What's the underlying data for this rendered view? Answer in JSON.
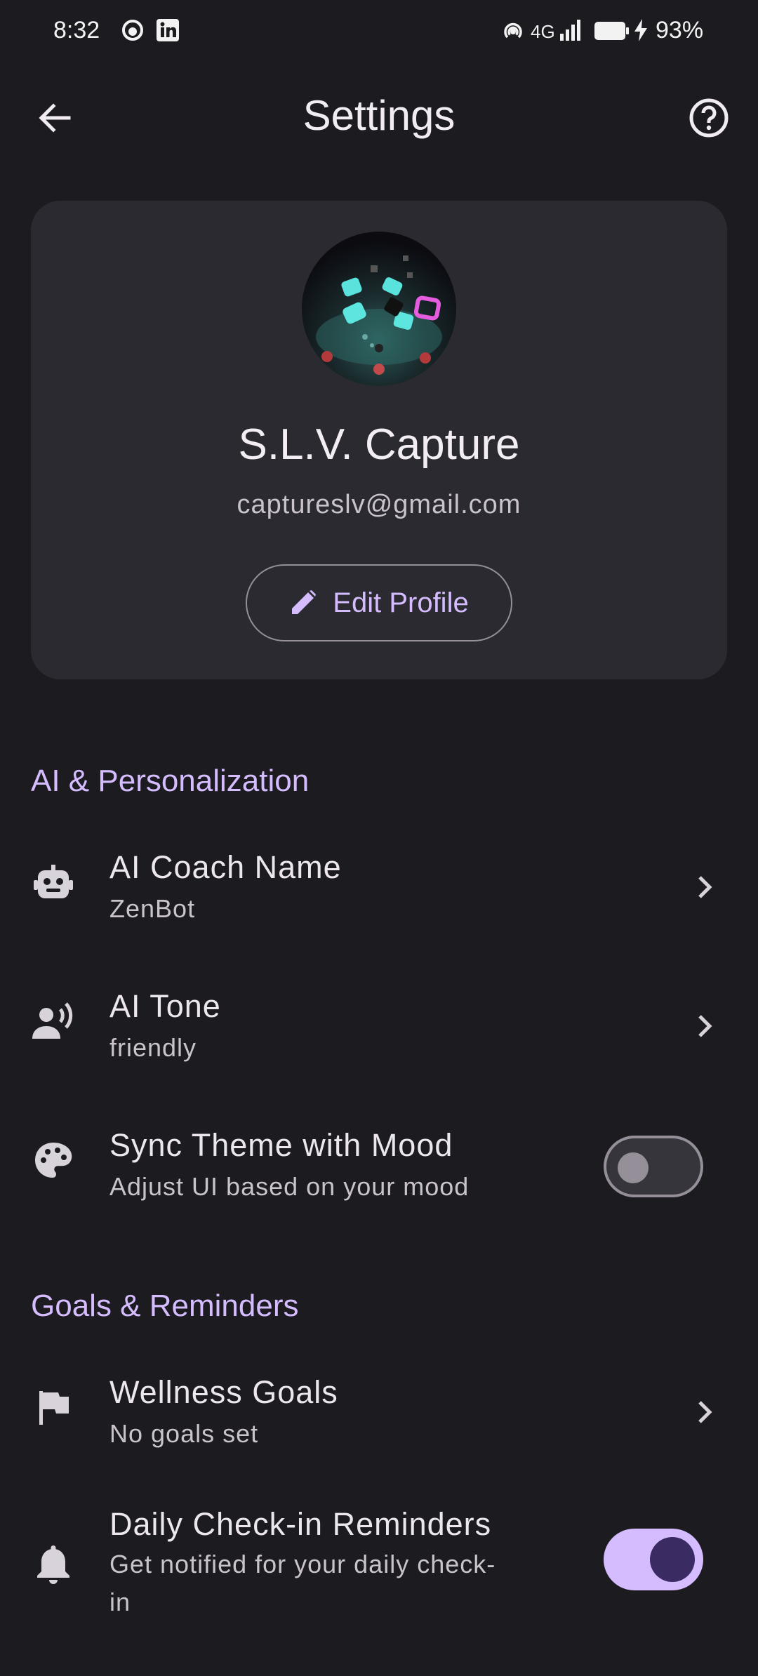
{
  "status_bar": {
    "time": "8:32",
    "network": "4G",
    "battery": "93%",
    "left_icons": [
      "notification-app-icon",
      "linkedin-icon"
    ],
    "right_icons": [
      "hotspot-icon",
      "signal-icon",
      "battery-icon",
      "charging-icon"
    ]
  },
  "app_bar": {
    "title": "Settings",
    "back_icon": "arrow-back-icon",
    "help_icon": "help-circle-icon"
  },
  "profile": {
    "name": "S.L.V. Capture",
    "email": "captureslv@gmail.com",
    "edit_label": "Edit Profile"
  },
  "sections": {
    "ai": {
      "title": "AI & Personalization",
      "items": [
        {
          "title": "AI Coach Name",
          "subtitle": "ZenBot",
          "icon": "robot-icon",
          "control": "chevron"
        },
        {
          "title": "AI Tone",
          "subtitle": "friendly",
          "icon": "voice-person-icon",
          "control": "chevron"
        },
        {
          "title": "Sync Theme with Mood",
          "subtitle": "Adjust UI based on your mood",
          "icon": "palette-icon",
          "control": "toggle",
          "enabled": false
        }
      ]
    },
    "goals": {
      "title": "Goals & Reminders",
      "items": [
        {
          "title": "Wellness Goals",
          "subtitle": "No goals set",
          "icon": "flag-icon",
          "control": "chevron"
        },
        {
          "title": "Daily Check-in Reminders",
          "subtitle_line1": "Get notified for your daily check-",
          "subtitle_line2": "in",
          "icon": "bell-icon",
          "control": "toggle",
          "enabled": true
        }
      ]
    }
  },
  "colors": {
    "background": "#1c1b20",
    "card": "#2b2a30",
    "accent": "#d4bcff",
    "toggle_knob_on": "#3b2b63"
  }
}
